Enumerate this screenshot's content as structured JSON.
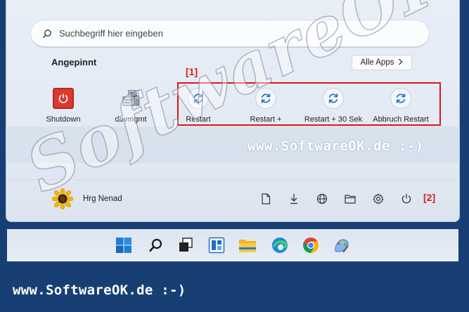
{
  "search": {
    "placeholder": "Suchbegriff hier eingeben"
  },
  "pinned": {
    "title": "Angepinnt",
    "all_apps_label": "Alle Apps",
    "items": [
      {
        "label": "Shutdown",
        "icon": "shutdown-icon"
      },
      {
        "label": "devmgmt",
        "icon": "device-manager-icon"
      },
      {
        "label": "Restart",
        "icon": "restart-icon"
      },
      {
        "label": "Restart +",
        "icon": "restart-icon"
      },
      {
        "label": "Restart + 30 Sek",
        "icon": "restart-icon"
      },
      {
        "label": "Abbruch Restart",
        "icon": "restart-icon"
      }
    ]
  },
  "annotations": {
    "marker1": "[1]",
    "marker2": "[2]"
  },
  "user": {
    "name": "Hrg Nenad",
    "avatar": "sunflower-avatar"
  },
  "system_icons": [
    "document-icon",
    "download-icon",
    "network-icon",
    "file-explorer-icon",
    "settings-icon",
    "power-icon"
  ],
  "taskbar": {
    "icons": [
      "windows-start-icon",
      "search-icon",
      "task-view-icon",
      "widgets-icon",
      "file-explorer-icon",
      "edge-icon",
      "chrome-icon",
      "paint-icon"
    ]
  },
  "watermark": {
    "big_text": "SoftwareOK.de",
    "mid_text": "www.SoftwareOK.de :-)",
    "footer_text": "www.SoftwareOK.de :-)"
  },
  "colors": {
    "background": "#173f73",
    "accent": "#1f6fc9",
    "annotation_red": "#e01515",
    "shutdown_red": "#d83b2f"
  }
}
